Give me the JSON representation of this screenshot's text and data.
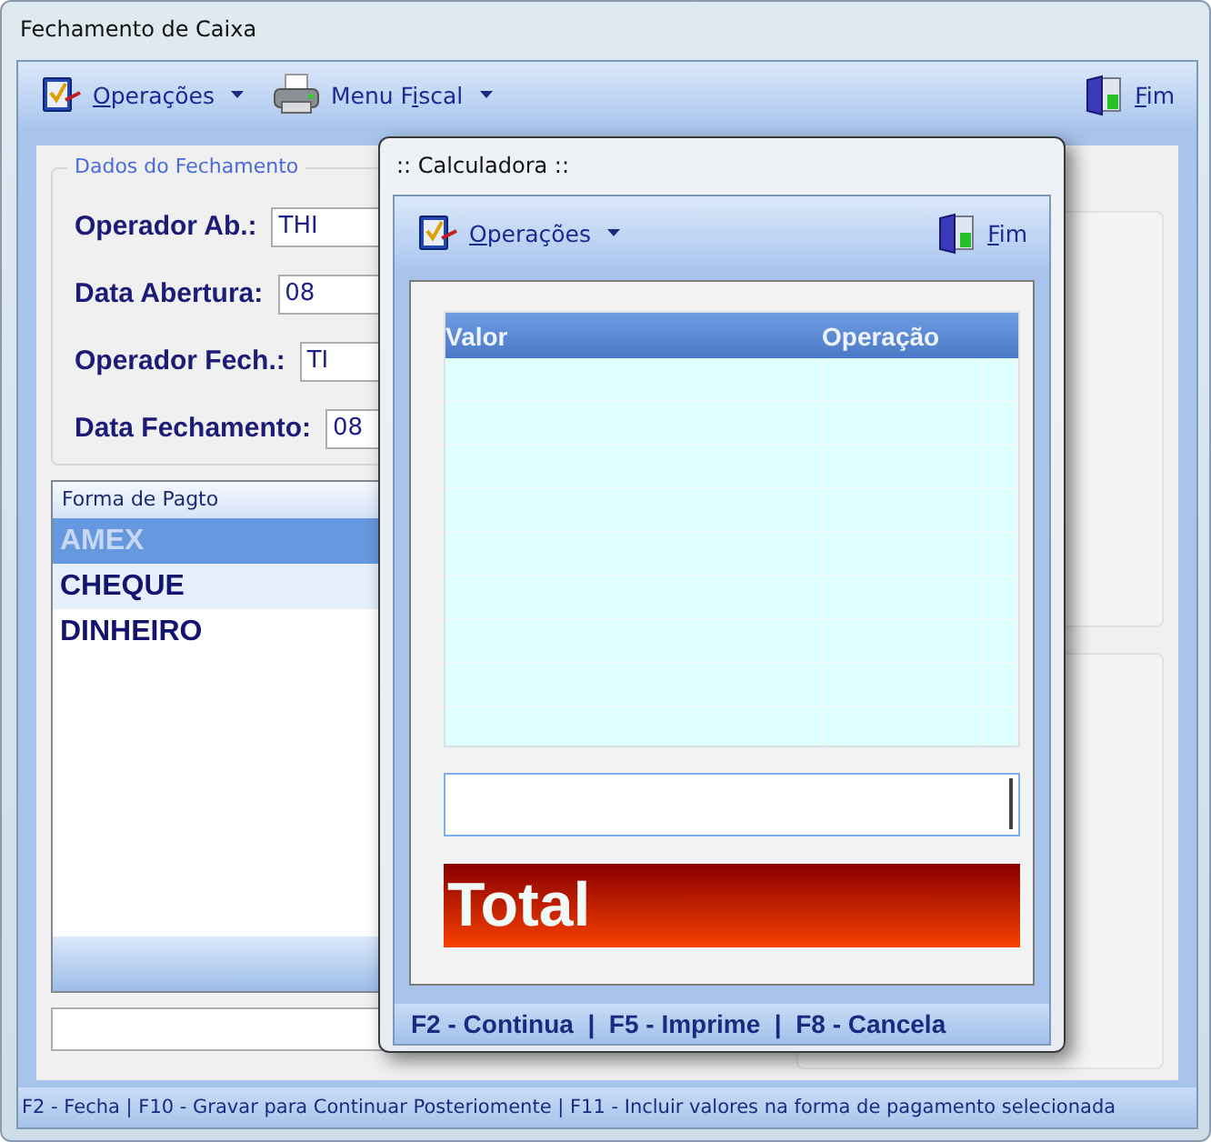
{
  "window": {
    "title": "Fechamento de Caixa"
  },
  "toolbar": {
    "items": [
      {
        "kind": "checklist",
        "mnemonic": "O",
        "label_after": "perações",
        "dropdown": true
      },
      {
        "kind": "printer",
        "label_before": "Menu F",
        "mnemonic": "i",
        "label_after": "scal",
        "dropdown": true
      },
      {
        "kind": "door",
        "mnemonic": "F",
        "label_after": "im",
        "dropdown": false
      }
    ]
  },
  "closing_data": {
    "title": "Dados do Fechamento",
    "fields": [
      {
        "label": "Operador Ab.:",
        "value": "THI"
      },
      {
        "label": "Data Abertura:",
        "value": "08"
      },
      {
        "label": "Operador Fech.:",
        "value": "TI"
      },
      {
        "label": "Data Fechamento:",
        "value": "08"
      }
    ]
  },
  "payment_list": {
    "header": "Forma de Pagto",
    "items": [
      {
        "label": "AMEX",
        "selected": true,
        "highlighted": false
      },
      {
        "label": "CHEQUE",
        "selected": false,
        "highlighted": true
      },
      {
        "label": "DINHEIRO",
        "selected": false,
        "highlighted": false
      }
    ]
  },
  "status_bar": "F2 - Fecha | F10 - Gravar para Continuar Posteriomente | F11 - Incluir valores na forma de pagamento selecionada",
  "calculator": {
    "title": ":: Calculadora ::",
    "toolbar": {
      "items": [
        {
          "kind": "checklist",
          "mnemonic": "O",
          "label_after": "perações",
          "dropdown": true
        },
        {
          "kind": "door",
          "mnemonic": "F",
          "label_after": "im",
          "dropdown": false
        }
      ]
    },
    "columns": [
      "Valor",
      "Operação"
    ],
    "total": "Total",
    "footer": "F2 - Continua  |  F5 - Imprime  |  F8 - Cancela"
  }
}
